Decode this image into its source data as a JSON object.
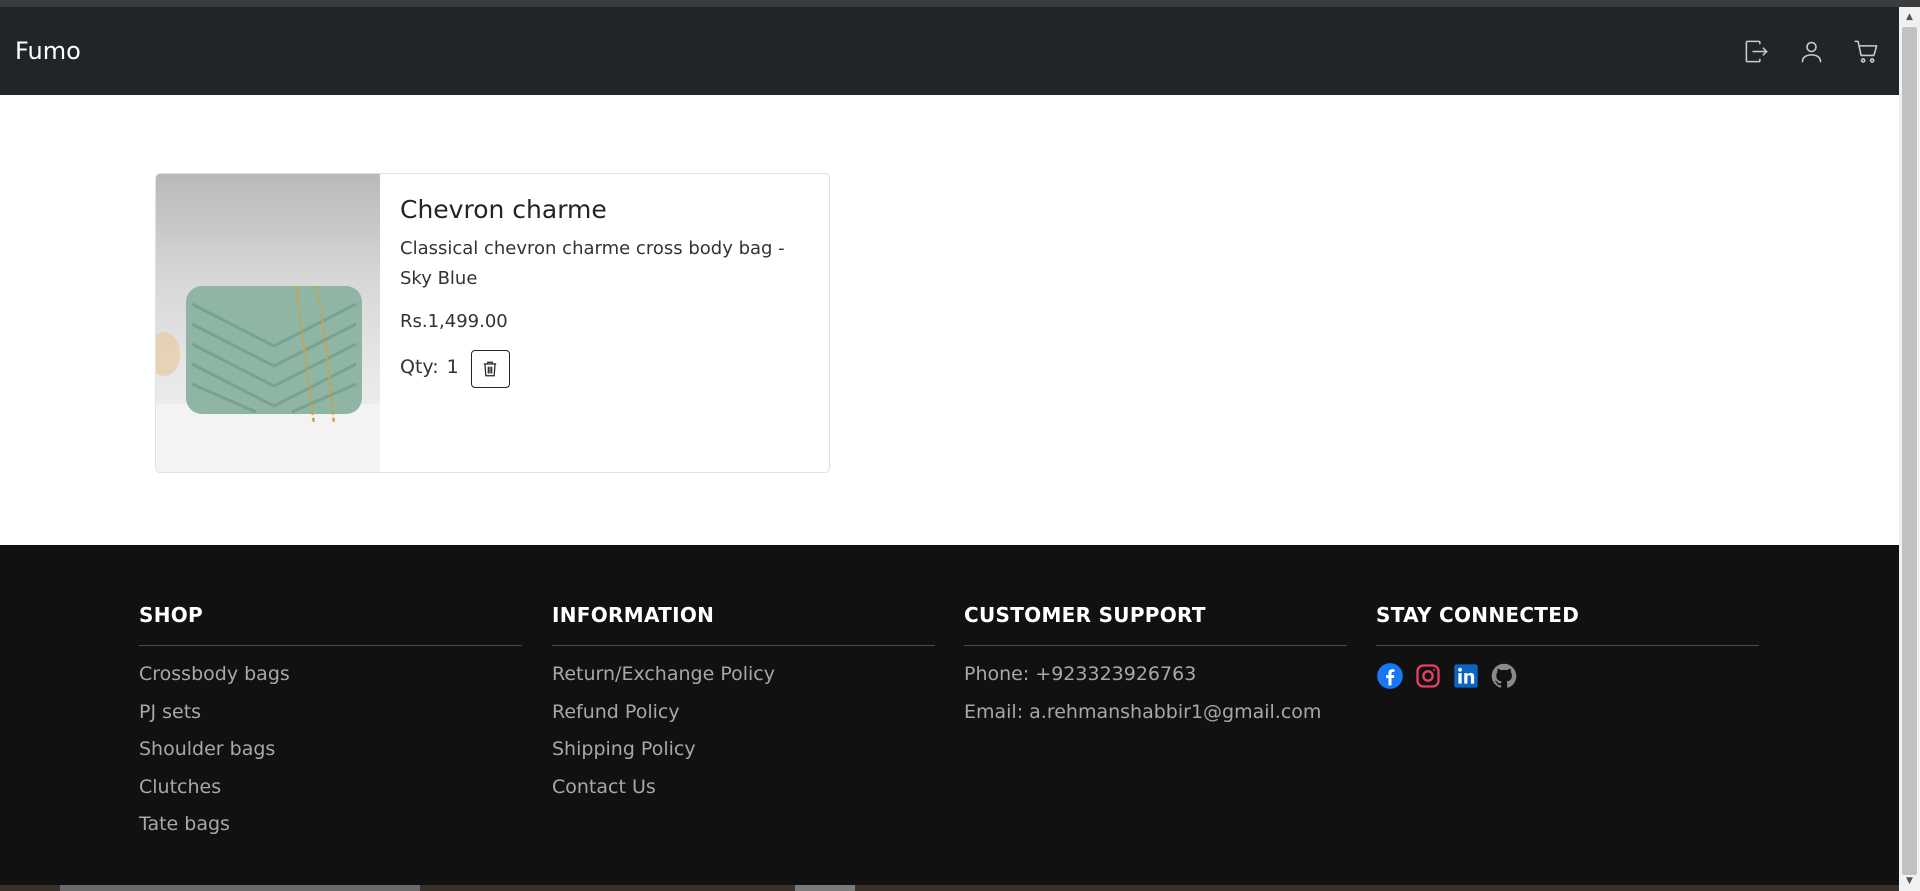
{
  "navbar": {
    "brand": "Fumo",
    "icons": [
      "logout-icon",
      "user-icon",
      "cart-icon"
    ]
  },
  "cart": {
    "items": [
      {
        "title": "Chevron charme",
        "description": "Classical chevron charme cross body bag - Sky Blue",
        "price": "Rs.1,499.00",
        "qty_label": "Qty:",
        "qty_value": "1",
        "image_color": "#8fb5a4"
      }
    ]
  },
  "footer": {
    "shop": {
      "heading": "SHOP",
      "links": [
        "Crossbody bags",
        "PJ sets",
        "Shoulder bags",
        "Clutches",
        "Tate bags"
      ]
    },
    "information": {
      "heading": "INFORMATION",
      "links": [
        "Return/Exchange Policy",
        "Refund Policy",
        "Shipping Policy",
        "Contact Us"
      ]
    },
    "support": {
      "heading": "CUSTOMER SUPPORT",
      "phone": "Phone: +923323926763",
      "email": "Email: a.rehmanshabbir1@gmail.com"
    },
    "connect": {
      "heading": "STAY CONNECTED",
      "socials": [
        "facebook-icon",
        "instagram-icon",
        "linkedin-icon",
        "github-icon"
      ]
    }
  },
  "colors": {
    "navbar_bg": "#212529",
    "footer_bg": "#111111",
    "facebook": "#1877f2",
    "instagram": "#e4405f",
    "linkedin": "#0a66c2",
    "github": "#8a8a8a"
  }
}
